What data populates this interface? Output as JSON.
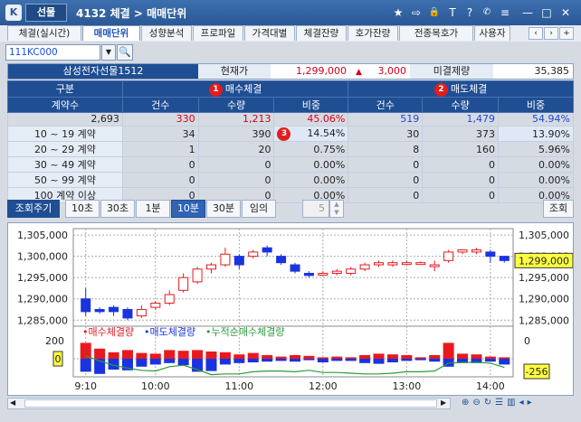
{
  "window": {
    "logo": "K",
    "market_tab": "선물",
    "screen_no": "4132",
    "title_a": "체결 > ",
    "title_b": "매매단위",
    "controls": [
      "★",
      "⇨",
      "🔒",
      "T",
      "?",
      "✆",
      "≡",
      "—",
      "□",
      "✕"
    ]
  },
  "tabs": [
    "체결(실시간)",
    "매매단위",
    "성향분석",
    "프로파일",
    "가격대별",
    "체결잔량",
    "호가잔량",
    "전종목호가",
    "사용자"
  ],
  "search": {
    "value": "111KC000"
  },
  "info": {
    "name": "삼성전자선물1512",
    "price_label": "현재가",
    "price": "1,299,000",
    "change_arrow": "▲",
    "change": "3,000",
    "oi_label": "미결제량",
    "oi": "35,385"
  },
  "table": {
    "h_group": "구분",
    "h_buy": "매수체결",
    "h_sell": "매도체결",
    "badges": [
      "1",
      "2",
      "3"
    ],
    "h_lot": "계약수",
    "h_cols": [
      "건수",
      "수량",
      "비중"
    ],
    "rows": [
      {
        "label": "",
        "b_cnt": "330",
        "b_qty": "1,213",
        "b_pct": "45.06%",
        "s_cnt": "519",
        "s_qty": "1,479",
        "s_pct": "54.94%",
        "lot": "2,693"
      },
      {
        "label": "10 ~ 19 계약",
        "b_cnt": "34",
        "b_qty": "390",
        "b_pct": "14.54%",
        "s_cnt": "30",
        "s_qty": "373",
        "s_pct": "13.90%"
      },
      {
        "label": "20 ~ 29 계약",
        "b_cnt": "1",
        "b_qty": "20",
        "b_pct": "0.75%",
        "s_cnt": "8",
        "s_qty": "160",
        "s_pct": "5.96%"
      },
      {
        "label": "30 ~ 49 계약",
        "b_cnt": "0",
        "b_qty": "0",
        "b_pct": "0.00%",
        "s_cnt": "0",
        "s_qty": "0",
        "s_pct": "0.00%"
      },
      {
        "label": "50 ~ 99 계약",
        "b_cnt": "0",
        "b_qty": "0",
        "b_pct": "0.00%",
        "s_cnt": "0",
        "s_qty": "0",
        "s_pct": "0.00%"
      },
      {
        "label": "100 계약 이상",
        "b_cnt": "0",
        "b_qty": "0",
        "b_pct": "0.00%",
        "s_cnt": "0",
        "s_qty": "0",
        "s_pct": "0.00%"
      }
    ]
  },
  "period": {
    "label": "조회주기",
    "buttons": [
      "10초",
      "30초",
      "1분",
      "10분",
      "30분",
      "임의"
    ],
    "active": "10분",
    "spin_value": "5",
    "query_button": "조회"
  },
  "chart_data": {
    "type": "candlestick",
    "price_axis": {
      "ticks": [
        "1,305,000",
        "1,300,000",
        "1,295,000",
        "1,290,000",
        "1,285,000"
      ],
      "min": 1284000,
      "max": 1306500
    },
    "current_price_label": "1,299,000",
    "current_price": 1299000,
    "time_ticks": [
      "9:10",
      "10:00",
      "11:00",
      "12:00",
      "13:00",
      "14:00"
    ],
    "candles": [
      {
        "o": 1290000,
        "c": 1287000,
        "h": 1292500,
        "l": 1286000
      },
      {
        "o": 1287500,
        "c": 1287000,
        "h": 1288000,
        "l": 1286500
      },
      {
        "o": 1288000,
        "c": 1287000,
        "h": 1288500,
        "l": 1286000
      },
      {
        "o": 1287500,
        "c": 1285500,
        "h": 1288000,
        "l": 1285000
      },
      {
        "o": 1286000,
        "c": 1287500,
        "h": 1288500,
        "l": 1285500
      },
      {
        "o": 1288000,
        "c": 1289000,
        "h": 1289500,
        "l": 1287500
      },
      {
        "o": 1289000,
        "c": 1291000,
        "h": 1292000,
        "l": 1288500
      },
      {
        "o": 1292000,
        "c": 1295000,
        "h": 1296000,
        "l": 1291500
      },
      {
        "o": 1294000,
        "c": 1297000,
        "h": 1297500,
        "l": 1293500
      },
      {
        "o": 1297000,
        "c": 1298000,
        "h": 1298500,
        "l": 1296000
      },
      {
        "o": 1298000,
        "c": 1300500,
        "h": 1302000,
        "l": 1297500
      },
      {
        "o": 1300000,
        "c": 1298000,
        "h": 1300500,
        "l": 1297000
      },
      {
        "o": 1300000,
        "c": 1301000,
        "h": 1301500,
        "l": 1299500
      },
      {
        "o": 1302000,
        "c": 1301000,
        "h": 1302500,
        "l": 1300000
      },
      {
        "o": 1300000,
        "c": 1298500,
        "h": 1300500,
        "l": 1298000
      },
      {
        "o": 1298000,
        "c": 1296500,
        "h": 1298500,
        "l": 1296000
      },
      {
        "o": 1296000,
        "c": 1295500,
        "h": 1296500,
        "l": 1295000
      },
      {
        "o": 1296000,
        "c": 1296000,
        "h": 1296500,
        "l": 1295500
      },
      {
        "o": 1296000,
        "c": 1296500,
        "h": 1297000,
        "l": 1295500
      },
      {
        "o": 1296000,
        "c": 1297000,
        "h": 1297500,
        "l": 1295500
      },
      {
        "o": 1297000,
        "c": 1298000,
        "h": 1298500,
        "l": 1296500
      },
      {
        "o": 1298000,
        "c": 1298500,
        "h": 1299000,
        "l": 1297500
      },
      {
        "o": 1298000,
        "c": 1298500,
        "h": 1299000,
        "l": 1297500
      },
      {
        "o": 1298500,
        "c": 1298500,
        "h": 1299000,
        "l": 1298000
      },
      {
        "o": 1298500,
        "c": 1298500,
        "h": 1298800,
        "l": 1298200
      },
      {
        "o": 1298000,
        "c": 1298000,
        "h": 1299000,
        "l": 1296500
      },
      {
        "o": 1299000,
        "c": 1301000,
        "h": 1301500,
        "l": 1298500
      },
      {
        "o": 1301000,
        "c": 1301500,
        "h": 1301500,
        "l": 1300500
      },
      {
        "o": 1301000,
        "c": 1301500,
        "h": 1302000,
        "l": 1300500
      },
      {
        "o": 1301000,
        "c": 1300000,
        "h": 1301500,
        "l": 1298500
      },
      {
        "o": 1300000,
        "c": 1299000,
        "h": 1300000,
        "l": 1298500
      }
    ],
    "volume_legend": [
      "매수체결량",
      "매도체결량",
      "누적순매수체결량"
    ],
    "volume_axis_left": [
      "200",
      "0"
    ],
    "volume_axis_right": [
      "0",
      "-256"
    ],
    "buy_volume": [
      110,
      70,
      45,
      60,
      40,
      35,
      60,
      55,
      60,
      50,
      45,
      30,
      40,
      25,
      15,
      25,
      20,
      10,
      15,
      10,
      25,
      35,
      30,
      25,
      10,
      25,
      110,
      35,
      30,
      15,
      10
    ],
    "sell_volume": [
      90,
      105,
      75,
      80,
      55,
      40,
      30,
      45,
      90,
      85,
      40,
      30,
      25,
      20,
      15,
      20,
      10,
      25,
      15,
      15,
      30,
      35,
      25,
      15,
      10,
      20,
      55,
      30,
      30,
      20,
      40
    ],
    "cum_net": [
      20,
      -15,
      -45,
      -65,
      -80,
      -85,
      -55,
      -45,
      -75,
      -110,
      -105,
      -105,
      -90,
      -85,
      -85,
      -90,
      -80,
      -95,
      -95,
      -100,
      -105,
      -105,
      -100,
      -90,
      -90,
      -85,
      -30,
      -25,
      -25,
      -30,
      -60
    ],
    "colors": {
      "up": "#e8191e",
      "down": "#1a33e0",
      "cum": "#2b9b3a"
    }
  },
  "status_icons": [
    "zoom-in-icon",
    "zoom-out-icon",
    "refresh-icon",
    "list-icon",
    "bars-icon",
    "scroll-left-icon",
    "scroll-right-icon"
  ]
}
